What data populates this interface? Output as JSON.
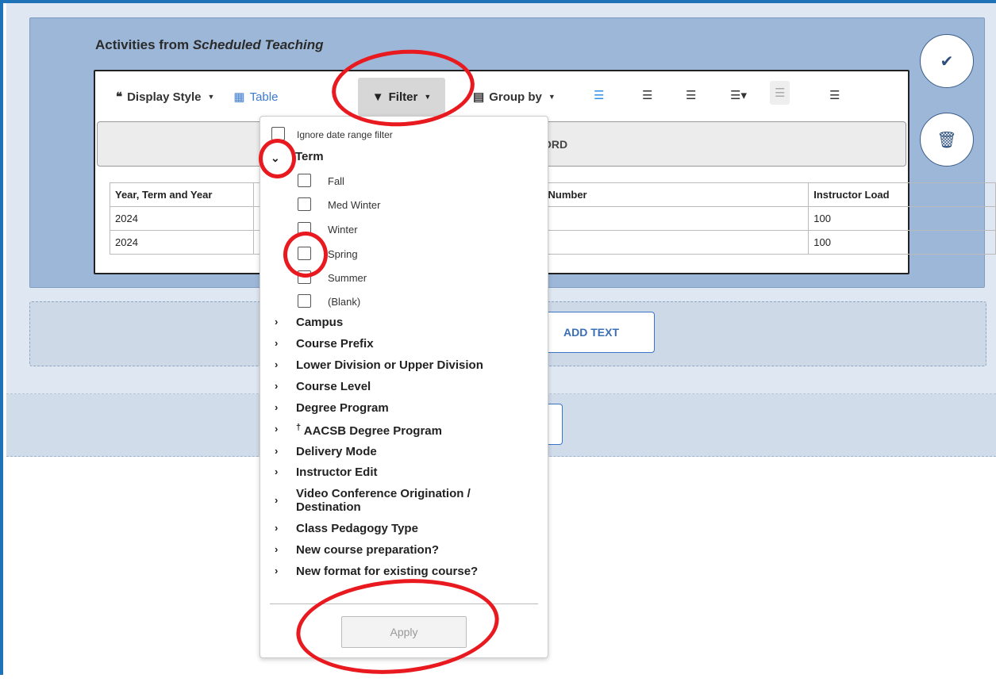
{
  "panel": {
    "title_prefix": "Activities from ",
    "title_emphasis": "Scheduled Teaching"
  },
  "toolbar": {
    "display_style": "Display Style",
    "table": "Table",
    "filter": "Filter",
    "group_by": "Group by"
  },
  "header_bar": {
    "text_fragment": "ORD"
  },
  "table": {
    "headers": [
      "Year, Term and Year",
      "e Number",
      "Instructor Load"
    ],
    "rows": [
      [
        "2024",
        "",
        "100"
      ],
      [
        "2024",
        "",
        "100"
      ]
    ]
  },
  "side_buttons": {
    "confirm_icon": "check-icon",
    "delete_icon": "trash-icon"
  },
  "add_text": "ADD TEXT",
  "dropdown": {
    "ignore_label": "Ignore date range filter",
    "term_label": "Term",
    "term_options": [
      "Fall",
      "Med Winter",
      "Winter",
      "Spring",
      "Summer",
      "(Blank)"
    ],
    "groups": [
      "Campus",
      "Course Prefix",
      "Lower Division or Upper Division",
      "Course Level",
      "Degree Program",
      "AACSB Degree Program",
      "Delivery Mode",
      "Instructor Edit",
      "Video Conference Origination /",
      "Destination",
      "Class Pedagogy Type",
      "New course preparation?",
      "New format for existing course?"
    ],
    "dagger": "†",
    "apply": "Apply"
  },
  "colors": {
    "frame_blue": "#1e72b8",
    "panel_blue": "#9db7d8",
    "annotation_red": "#e8191f",
    "link_blue": "#3b7bd0"
  }
}
